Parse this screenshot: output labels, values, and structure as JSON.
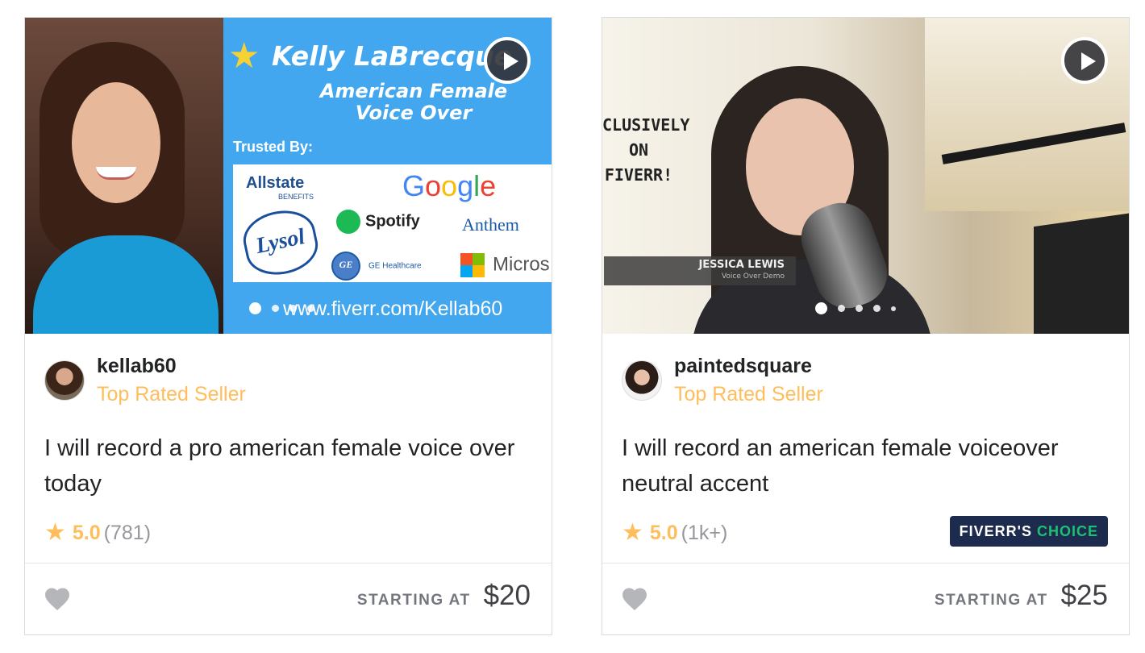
{
  "colors": {
    "level_color": "#ffbe5b",
    "star_color": "#ffbe5b",
    "badge_bg": "#1d2b4f",
    "badge_accent": "#1dbf73"
  },
  "cards": [
    {
      "seller": {
        "name": "kellab60",
        "level": "Top Rated Seller"
      },
      "title": "I will record a pro american female voice over today",
      "rating": {
        "value": "5.0",
        "count": "(781)"
      },
      "price_label": "STARTING AT",
      "price": "$20",
      "media": {
        "headline": "Kelly LaBrecque",
        "subtitle_line1": "American Female",
        "subtitle_line2": "Voice Over",
        "trusted_by": "Trusted By:",
        "logos": {
          "allstate": "Allstate",
          "allstate_sub": "BENEFITS",
          "google": "Google",
          "spotify": "Spotify",
          "anthem": "Anthem",
          "lysol": "Lysol",
          "ge": "GE Healthcare",
          "microsoft": "Micros"
        },
        "url": "www.fiverr.com/Kellab60"
      }
    },
    {
      "seller": {
        "name": "paintedsquare",
        "level": "Top Rated Seller"
      },
      "title": "I will record an american female voiceover neutral accent",
      "rating": {
        "value": "5.0",
        "count": "(1k+)"
      },
      "badge": {
        "part1": "FIVERR'S",
        "part2": "CHOICE"
      },
      "price_label": "STARTING AT",
      "price": "$25",
      "media": {
        "overlay_line1": "CLUSIVELY",
        "overlay_line2": "ON",
        "overlay_line3": "FIVERR!",
        "name_tag": "JESSICA LEWIS",
        "name_tag_sub": "Voice Over Demo"
      }
    }
  ],
  "icons": {
    "play": "play-icon",
    "star": "star-icon",
    "heart": "heart-icon"
  }
}
